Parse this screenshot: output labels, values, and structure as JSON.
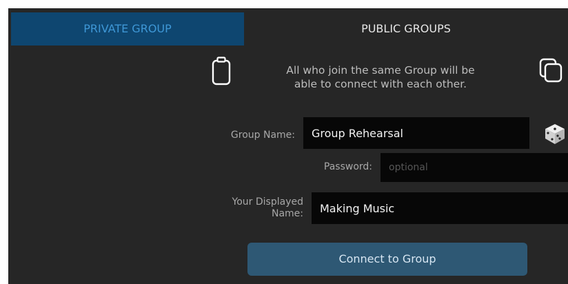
{
  "tabs": {
    "private": "PRIVATE GROUP",
    "public": "PUBLIC GROUPS"
  },
  "info_line1": "All who join the same Group will be",
  "info_line2": "able to connect with each other.",
  "form": {
    "group_name_label": "Group Name:",
    "group_name_value": "Group Rehearsal",
    "password_label": "Password:",
    "password_placeholder": "optional",
    "displayed_name_label_line1": "Your Displayed",
    "displayed_name_label_line2": "Name:",
    "displayed_name_value": "Making Music"
  },
  "connect_label": "Connect to Group",
  "icons": {
    "paste": "clipboard-icon",
    "copy": "copy-icon",
    "random": "dice-icon"
  },
  "colors": {
    "active_tab_bg": "#0e4670",
    "active_tab_text": "#3e97d6",
    "panel_bg": "#262626",
    "field_bg": "#070707",
    "button_bg": "#2e5874"
  }
}
